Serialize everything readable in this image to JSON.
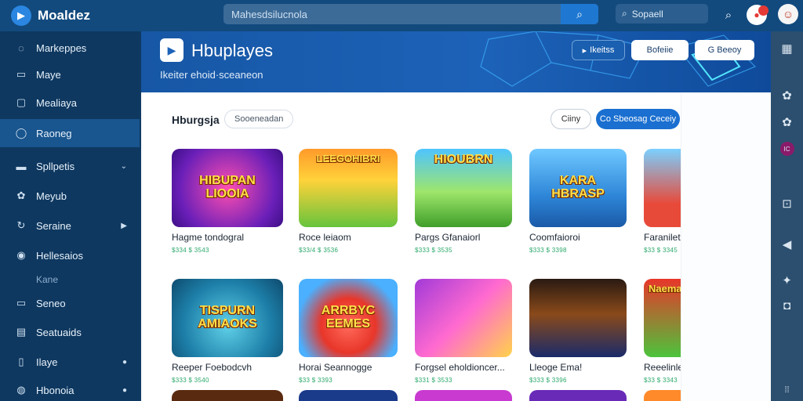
{
  "app": {
    "name": "Moaldez"
  },
  "topbar": {
    "search_value": "Mahesdsilucnola",
    "search_placeholder": "Mahesdsilucnola",
    "small_search_label": "Sopaell",
    "notif_count": "1",
    "avatar_badge": "IC"
  },
  "sidebar": {
    "items": [
      {
        "label": "Markeppes",
        "icon": "chat-icon"
      },
      {
        "label": "Maye",
        "icon": "folder-icon"
      },
      {
        "label": "Mealiaya",
        "icon": "image-icon"
      },
      {
        "label": "Raoneg",
        "icon": "gamepad-icon",
        "active": true
      },
      {
        "label": "Spllpetis",
        "icon": "list-icon",
        "trail": "expand-arrow"
      },
      {
        "label": "Meyub",
        "icon": "gear-icon"
      },
      {
        "label": "Seraine",
        "icon": "refresh-icon",
        "trail": "triangle"
      },
      {
        "label": "Hellesaios",
        "icon": "info-icon"
      }
    ],
    "section_label": "Kane",
    "items2": [
      {
        "label": "Seneo",
        "icon": "card-icon"
      },
      {
        "label": "Seatuaids",
        "icon": "doc-icon"
      },
      {
        "label": "Ilaye",
        "icon": "bookmark-icon",
        "dot": true
      },
      {
        "label": "Hbonoia",
        "icon": "user-icon",
        "dot": true
      }
    ]
  },
  "banner": {
    "title": "Hbuplayes",
    "subtitle": "Ikeiter   ehoid·sceaneon",
    "buttons": [
      {
        "label": "Ikeitss",
        "style": "blue"
      },
      {
        "label": "Bofeiie",
        "style": "white"
      },
      {
        "label": "G Beeoy",
        "style": "white"
      }
    ]
  },
  "section": {
    "title": "Hburgsja",
    "chip": "Sooeneadan",
    "btn_outline": "Ciiny",
    "btn_filled": "Co Sbeosag Ceceiy"
  },
  "cards": [
    {
      "title": "Hagme  tondogral",
      "price": "$334 $ 3543",
      "art": "HIBUPAN LIOOIA"
    },
    {
      "title": "Roce  leiaom",
      "price": "$33/4 $ 3536",
      "art": "LEEGOHIBRI"
    },
    {
      "title": "Pargs Gfanaiorl",
      "price": "$333 $ 3535",
      "art": "HIOUBRN"
    },
    {
      "title": "Coomfaioroi",
      "price": "$333 $ 3398",
      "art": "KARA HBRASP"
    },
    {
      "title": "Faraniletr",
      "price": "$33 $ 3345",
      "art": ""
    },
    {
      "title": "Reeper  Foebodcvh",
      "price": "$333 $ 3540",
      "art": "TISPURN AMIAOKS"
    },
    {
      "title": "Horai  Seannogge",
      "price": "$33 $ 3393",
      "art": "ARRBYC EEMES"
    },
    {
      "title": "Forgsel eholdioncer...",
      "price": "$331 $ 3533",
      "art": ""
    },
    {
      "title": "Lleoge  Ema!",
      "price": "$333 $ 3396",
      "art": ""
    },
    {
      "title": "Reeelinlei",
      "price": "$33 $ 3343",
      "art": "Naema"
    }
  ],
  "colors": {
    "accent": "#1a6fd0",
    "topbar": "#124a7e",
    "sidebar": "#0e3860",
    "price": "#2aa86a"
  }
}
